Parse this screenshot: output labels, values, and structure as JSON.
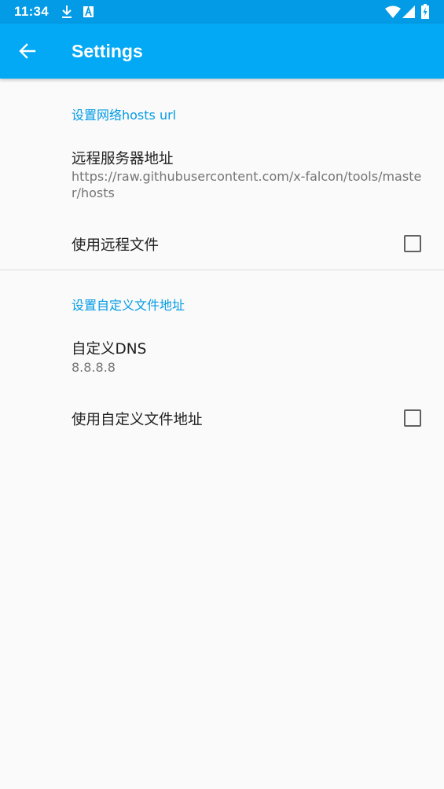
{
  "status_bar": {
    "time": "11:34",
    "icons": [
      "download-icon",
      "a-badge-icon",
      "wifi-icon",
      "signal-icon",
      "battery-charging-icon"
    ]
  },
  "app_bar": {
    "title": "Settings",
    "back_icon": "arrow-left-icon"
  },
  "sections": [
    {
      "category": "设置网络hosts url",
      "items": [
        {
          "title": "远程服务器地址",
          "summary": "https://raw.githubusercontent.com/x-falcon/tools/master/hosts"
        },
        {
          "title": "使用远程文件",
          "checked": false
        }
      ]
    },
    {
      "category": "设置自定义文件地址",
      "items": [
        {
          "title": "自定义DNS",
          "summary": "8.8.8.8"
        },
        {
          "title": "使用自定义文件地址",
          "checked": false
        }
      ]
    }
  ],
  "colors": {
    "status_bar": "#039be5",
    "app_bar": "#03a9f4",
    "accent": "#039be5",
    "background": "#fafafa"
  }
}
